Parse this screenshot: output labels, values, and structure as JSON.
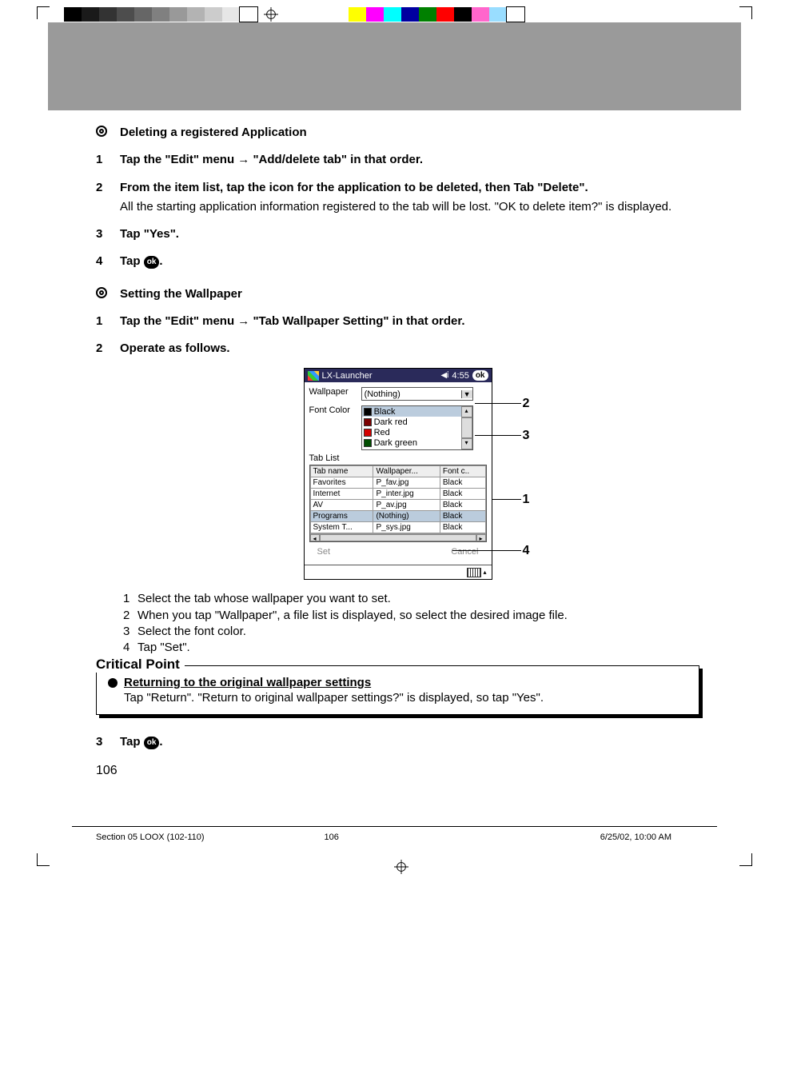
{
  "registration": {
    "cmyk_swatches": [
      "#000000",
      "#1a1a1a",
      "#333333",
      "#4d4d4d",
      "#666666",
      "#808080",
      "#999999",
      "#b3b3b3",
      "#cccccc",
      "#e6e6e6",
      "#ffffff"
    ],
    "process_swatches": [
      "#ffff00",
      "#ff00ff",
      "#00ffff",
      "#0000a0",
      "#008000",
      "#ff0000",
      "#000000",
      "#ff66cc",
      "#99ddff",
      "#ffffff"
    ]
  },
  "sections": {
    "deleteApp": {
      "heading": "Deleting a registered Application",
      "step1": "Tap the \"Edit\" menu → \"Add/delete tab\" in that order.",
      "step2a": "From the item list, tap the icon for the application to be deleted, then Tab \"Delete\".",
      "step2b": "All the starting application information registered to the tab will be lost. \"OK to delete item?\" is displayed.",
      "step3": "Tap \"Yes\".",
      "step4_pre": "Tap ",
      "step4_post": "."
    },
    "wallpaper": {
      "heading": "Setting the Wallpaper",
      "step1": "Tap the \"Edit\" menu → \"Tab Wallpaper Setting\" in that order.",
      "step2": "Operate as follows.",
      "substeps": {
        "s1": "Select the tab whose wallpaper you want to set.",
        "s2": "When you tap \"Wallpaper\", a file list is displayed, so select the desired image file.",
        "s3": "Select the font color.",
        "s4": "Tap \"Set\"."
      },
      "step3_pre": "Tap ",
      "step3_post": "."
    }
  },
  "screenshot": {
    "title": "LX-Launcher",
    "time": "4:55",
    "ok": "ok",
    "labels": {
      "wallpaper": "Wallpaper",
      "fontcolor": "Font Color",
      "tablist": "Tab List"
    },
    "dropdown_value": "(Nothing)",
    "colors": [
      {
        "name": "Black",
        "hex": "#000000",
        "selected": true
      },
      {
        "name": "Dark red",
        "hex": "#7b0000",
        "selected": false
      },
      {
        "name": "Red",
        "hex": "#d40000",
        "selected": false
      },
      {
        "name": "Dark green",
        "hex": "#004d00",
        "selected": false
      }
    ],
    "table": {
      "headers": [
        "Tab name",
        "Wallpaper...",
        "Font c.."
      ],
      "rows": [
        {
          "cells": [
            "Favorites",
            "P_fav.jpg",
            "Black"
          ],
          "selected": false
        },
        {
          "cells": [
            "Internet",
            "P_inter.jpg",
            "Black"
          ],
          "selected": false
        },
        {
          "cells": [
            "AV",
            "P_av.jpg",
            "Black"
          ],
          "selected": false
        },
        {
          "cells": [
            "Programs",
            "(Nothing)",
            "Black"
          ],
          "selected": true
        },
        {
          "cells": [
            "System T...",
            "P_sys.jpg",
            "Black"
          ],
          "selected": false
        }
      ]
    },
    "buttons": {
      "set": "Set",
      "cancel": "Cancel"
    },
    "callouts": {
      "c1": "1",
      "c2": "2",
      "c3": "3",
      "c4": "4"
    }
  },
  "critical": {
    "title": "Critical Point",
    "item_head": "Returning to the original wallpaper settings",
    "item_body": "Tap \"Return\". \"Return to original wallpaper settings?\" is displayed, so tap \"Yes\"."
  },
  "page_number": "106",
  "footer": {
    "left": "Section 05 LOOX (102-110)",
    "mid": "106",
    "right": "6/25/02, 10:00 AM"
  },
  "ok_label": "ok"
}
